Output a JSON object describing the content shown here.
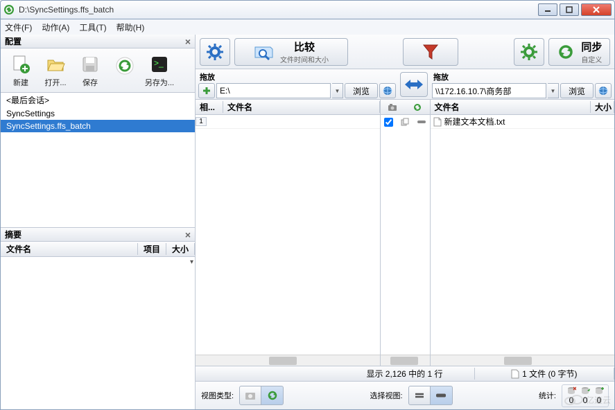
{
  "window": {
    "title": "D:\\SyncSettings.ffs_batch"
  },
  "menu": {
    "file": "文件(F)",
    "action": "动作(A)",
    "tools": "工具(T)",
    "help": "帮助(H)"
  },
  "config_panel": {
    "title": "配置",
    "buttons": {
      "new": "新建",
      "open": "打开...",
      "save": "保存",
      "saveas": "另存为..."
    },
    "items": [
      "<最后会话>",
      "SyncSettings",
      "SyncSettings.ffs_batch"
    ],
    "selected_index": 2
  },
  "summary_panel": {
    "title": "摘要",
    "cols": {
      "name": "文件名",
      "items": "项目",
      "size": "大小"
    }
  },
  "topbar": {
    "compare": {
      "label": "比较",
      "sub": "文件时间和大小"
    },
    "sync": {
      "label": "同步",
      "sub": "自定义"
    }
  },
  "paths": {
    "drop_label": "拖放",
    "browse": "浏览",
    "left": "E:\\",
    "right": "\\\\172.16.10.7\\商务部"
  },
  "grid": {
    "cols": {
      "rel": "相...",
      "name": "文件名",
      "size": "大小"
    },
    "left_rows": [
      {
        "num": "1",
        "name": ""
      }
    ],
    "right_rows": [
      {
        "name": "新建文本文档.txt"
      }
    ]
  },
  "status": {
    "center": "显示 2,126 中的 1 行",
    "right": "1 文件 (0 字节)"
  },
  "bottom": {
    "viewtype": "视图类型:",
    "selectview": "选择视图:",
    "stats": "统计:",
    "zeros": [
      "0",
      "0",
      "0"
    ]
  },
  "watermark": "亿速云"
}
